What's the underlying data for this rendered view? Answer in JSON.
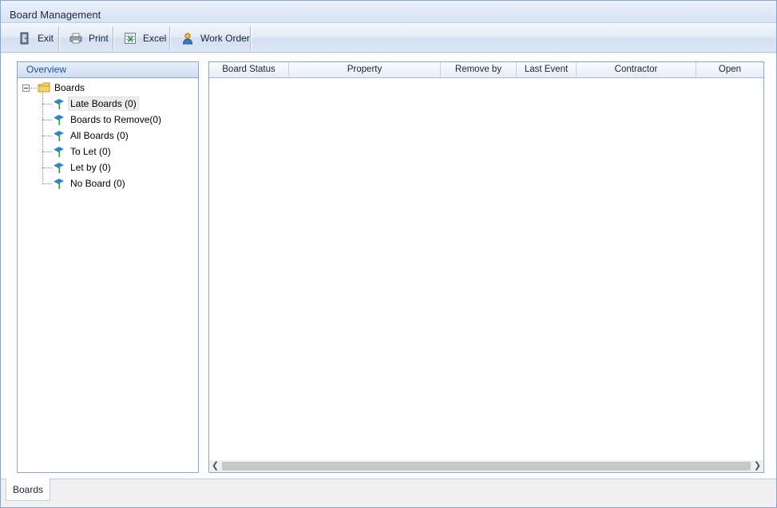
{
  "window": {
    "title": "Board Management"
  },
  "toolbar": {
    "buttons": [
      {
        "label": "Exit",
        "icon": "exit-door-icon"
      },
      {
        "label": "Print",
        "icon": "printer-icon"
      },
      {
        "label": "Excel",
        "icon": "excel-icon"
      },
      {
        "label": "Work Order",
        "icon": "user-icon"
      }
    ]
  },
  "overview": {
    "header": "Overview",
    "root": {
      "label": "Boards",
      "icon": "folder-icon"
    },
    "items": [
      {
        "label": "Late Boards (0)",
        "selected": true
      },
      {
        "label": "Boards to Remove(0)"
      },
      {
        "label": "All Boards (0)"
      },
      {
        "label": "To Let (0)"
      },
      {
        "label": "Let by (0)"
      },
      {
        "label": "No Board (0)"
      }
    ]
  },
  "grid": {
    "columns": [
      "Board Status",
      "Property",
      "Remove by",
      "Last Event",
      "Contractor",
      "Open"
    ],
    "rows": []
  },
  "tabs": [
    {
      "label": "Boards",
      "active": true
    }
  ],
  "colors": {
    "accent": "#1e4f9b",
    "border": "#8aa5cb",
    "toolbar": "#dde7f4"
  }
}
